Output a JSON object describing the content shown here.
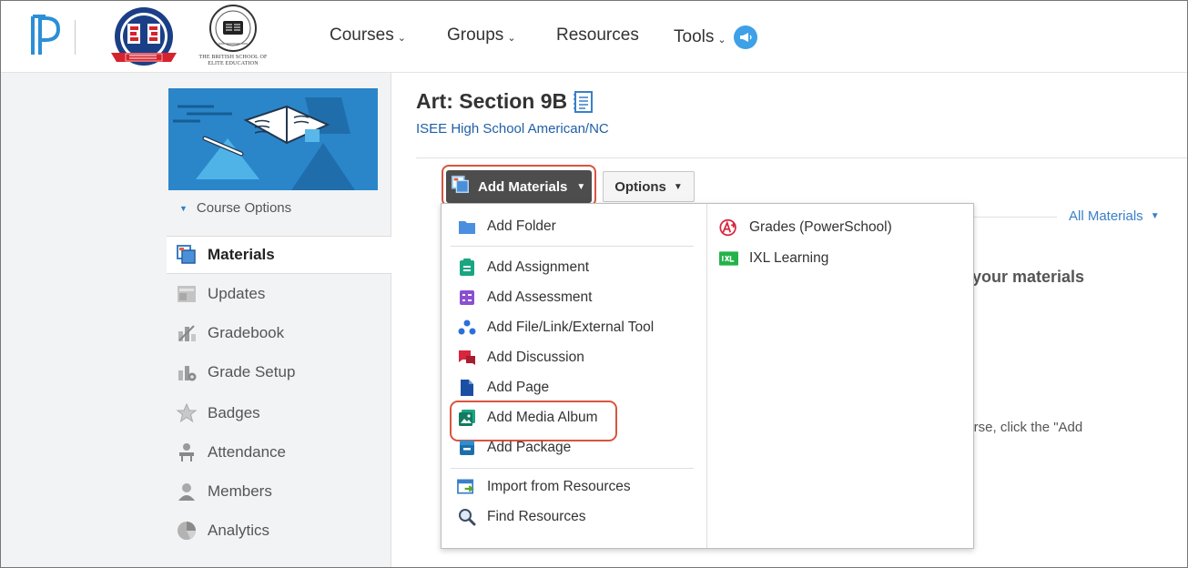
{
  "topnav": {
    "brand_caption": "THE BRITISH SCHOOL OF ELITE EDUCATION",
    "items": [
      {
        "label": "Courses",
        "has_chevron": true
      },
      {
        "label": "Groups",
        "has_chevron": true
      },
      {
        "label": "Resources",
        "has_chevron": false
      },
      {
        "label": "Tools",
        "has_chevron": true
      }
    ]
  },
  "sidebar": {
    "course_options": "Course Options",
    "items": [
      {
        "label": "Materials",
        "icon": "materials-icon",
        "active": true
      },
      {
        "label": "Updates",
        "icon": "updates-icon"
      },
      {
        "label": "Gradebook",
        "icon": "gradebook-icon"
      },
      {
        "label": "Grade Setup",
        "icon": "grade-setup-icon"
      },
      {
        "label": "Badges",
        "icon": "badge-icon"
      },
      {
        "label": "Attendance",
        "icon": "attendance-icon"
      },
      {
        "label": "Members",
        "icon": "members-icon"
      },
      {
        "label": "Analytics",
        "icon": "analytics-icon"
      }
    ]
  },
  "main": {
    "title": "Art: Section 9B",
    "subtitle": "ISEE High School American/NC",
    "add_materials": "Add Materials",
    "options": "Options",
    "filter": "All Materials",
    "background_text_1": "g your materials",
    "background_text_2": "ourse, click the \"Add"
  },
  "dropdown": {
    "left": [
      {
        "label": "Add Folder",
        "icon": "folder-icon"
      },
      {
        "label": "Add Assignment",
        "icon": "assignment-icon"
      },
      {
        "label": "Add Assessment",
        "icon": "assessment-icon"
      },
      {
        "label": "Add File/Link/External Tool",
        "icon": "file-link-icon"
      },
      {
        "label": "Add Discussion",
        "icon": "discussion-icon"
      },
      {
        "label": "Add Page",
        "icon": "page-icon"
      },
      {
        "label": "Add Media Album",
        "icon": "media-album-icon"
      },
      {
        "label": "Add Package",
        "icon": "package-icon"
      },
      {
        "label": "Import from Resources",
        "icon": "import-icon"
      },
      {
        "label": "Find Resources",
        "icon": "search-icon"
      }
    ],
    "right": [
      {
        "label": "Grades (PowerSchool)",
        "icon": "powerschool-grades-icon"
      },
      {
        "label": "IXL Learning",
        "icon": "ixl-icon"
      }
    ]
  },
  "colors": {
    "accent_blue": "#1f5fa6",
    "highlight_red": "#d9543e",
    "button_dark": "#4d4d4d",
    "sidebar_bg": "#f2f3f5"
  }
}
